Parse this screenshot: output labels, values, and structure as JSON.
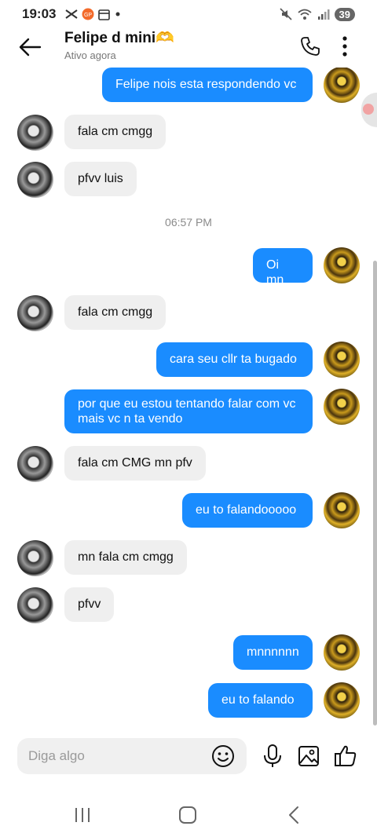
{
  "status_bar": {
    "time": "19:03",
    "battery": "39",
    "left_icons": [
      "capcut-icon",
      "app-icon-orange",
      "calendar-icon",
      "dot-icon"
    ],
    "right_icons": [
      "mute-icon",
      "wifi-icon",
      "signal-icon"
    ]
  },
  "header": {
    "title": "Felipe d mini🫶",
    "subtitle": "Ativo agora"
  },
  "messages": [
    {
      "from": "me",
      "text": "Felipe nois esta respondendo vc"
    },
    {
      "from": "friend",
      "text": "fala cm cmgg"
    },
    {
      "from": "friend",
      "text": "pfvv luis"
    },
    {
      "from": "timestamp",
      "text": "06:57 PM"
    },
    {
      "from": "me",
      "text": "Oi mn"
    },
    {
      "from": "friend",
      "text": "fala cm cmgg"
    },
    {
      "from": "me",
      "text": "cara seu cllr ta bugado"
    },
    {
      "from": "me",
      "text": "por que eu estou tentando falar com vc mais vc n ta vendo"
    },
    {
      "from": "friend",
      "text": "fala cm CMG mn pfv"
    },
    {
      "from": "me",
      "text": "eu to falandooooo"
    },
    {
      "from": "friend",
      "text": "mn fala cm cmgg"
    },
    {
      "from": "friend",
      "text": "pfvv"
    },
    {
      "from": "me",
      "text": "mnnnnnn"
    },
    {
      "from": "me",
      "text": "eu to falando"
    }
  ],
  "composer": {
    "placeholder": "Diga algo"
  },
  "colors": {
    "outgoing_bubble": "#1a8cff",
    "incoming_bubble": "#efefef"
  }
}
